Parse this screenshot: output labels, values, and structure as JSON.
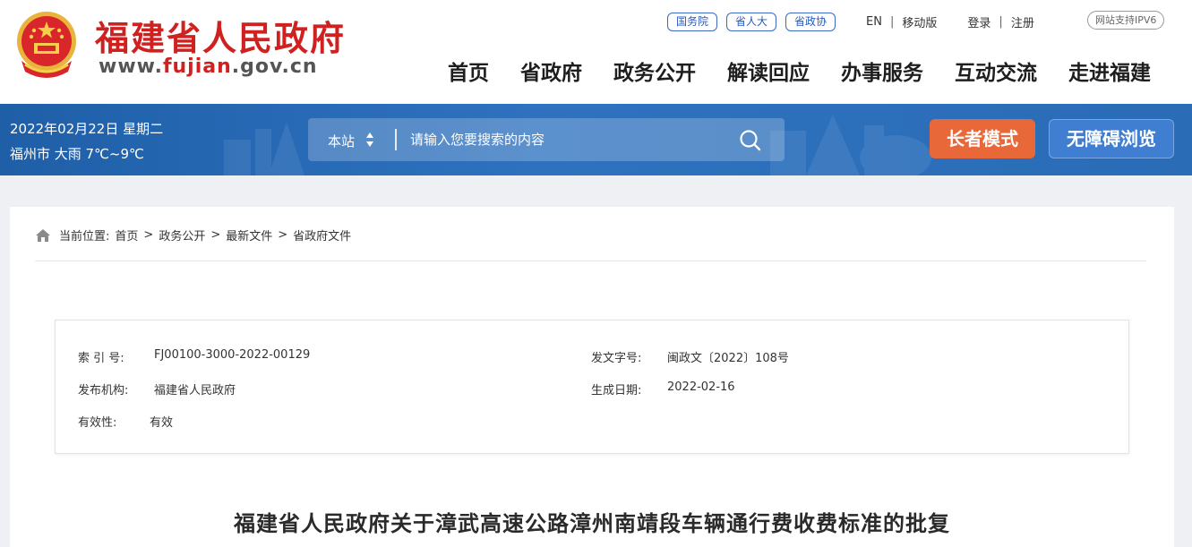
{
  "header": {
    "site_title": "福建省人民政府",
    "site_url_prefix": "www.",
    "site_url_highlight": "fujian",
    "site_url_suffix": ".gov.cn",
    "emblem_icon": "national-emblem-icon",
    "top_pills": [
      "国务院",
      "省人大",
      "省政协"
    ],
    "lang_en": "EN",
    "mobile": "移动版",
    "login": "登录",
    "register": "注册",
    "ipv6": "网站支持IPV6",
    "nav": [
      "首页",
      "省政府",
      "政务公开",
      "解读回应",
      "办事服务",
      "互动交流",
      "走进福建"
    ]
  },
  "band": {
    "date": "2022年02月22日 星期二",
    "weather": "福州市 大雨 7℃~9℃",
    "search_scope": "本站",
    "search_placeholder": "请输入您要搜索的内容",
    "elder_mode": "长者模式",
    "accessible": "无障碍浏览"
  },
  "breadcrumb": {
    "prefix": "当前位置:",
    "items": [
      "首页",
      "政务公开",
      "最新文件",
      "省政府文件"
    ],
    "separator": ">"
  },
  "meta": {
    "index_label": "索 引 号:",
    "index_value": "FJ00100-3000-2022-00129",
    "docno_label": "发文字号:",
    "docno_value": "闽政文〔2022〕108号",
    "issuer_label": "发布机构:",
    "issuer_value": "福建省人民政府",
    "date_label": "生成日期:",
    "date_value": "2022-02-16",
    "validity_label": "有效性:",
    "validity_value": "有效"
  },
  "document": {
    "title": "福建省人民政府关于漳武高速公路漳州南靖段车辆通行费收费标准的批复"
  },
  "colors": {
    "brand_red": "#d02121",
    "band_blue": "#2a6cb6",
    "elder_orange": "#e8683a",
    "access_blue": "#3f7ed0"
  }
}
